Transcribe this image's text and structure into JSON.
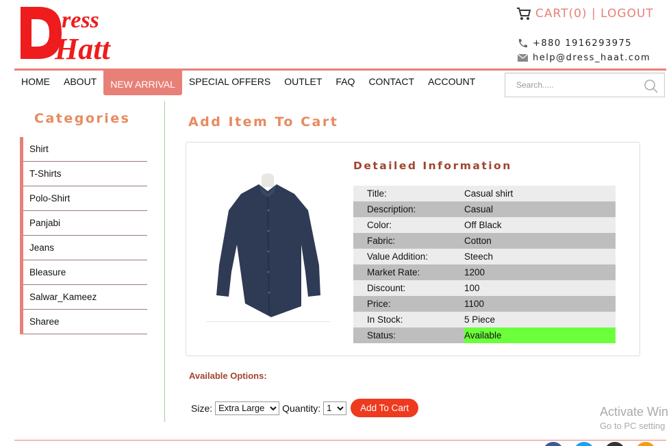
{
  "header": {
    "logo_text": "Dress Haat",
    "cart_label": "CART(0) | LOGOUT",
    "phone": "+880 1916293975",
    "email": "help@dress_haat.com"
  },
  "nav": {
    "items": [
      {
        "label": "HOME"
      },
      {
        "label": "ABOUT"
      },
      {
        "label": "NEW ARRIVAL",
        "active": true
      },
      {
        "label": "SPECIAL OFFERS"
      },
      {
        "label": "OUTLET"
      },
      {
        "label": "FAQ"
      },
      {
        "label": "CONTACT"
      },
      {
        "label": "ACCOUNT"
      }
    ]
  },
  "search": {
    "placeholder": "Search.....",
    "value": ""
  },
  "sidebar": {
    "title": "Categories",
    "items": [
      {
        "label": "Shirt"
      },
      {
        "label": "T-Shirts"
      },
      {
        "label": "Polo-Shirt"
      },
      {
        "label": "Panjabi"
      },
      {
        "label": "Jeans"
      },
      {
        "label": "Bleasure"
      },
      {
        "label": "Salwar_Kameez"
      },
      {
        "label": "Sharee"
      }
    ]
  },
  "main": {
    "title": "Add Item To Cart",
    "detail_title": "Detailed Information",
    "details": [
      {
        "key": "Title:",
        "value": "Casual shirt"
      },
      {
        "key": "Description:",
        "value": "Casual"
      },
      {
        "key": "Color:",
        "value": "Off Black"
      },
      {
        "key": "Fabric:",
        "value": "Cotton"
      },
      {
        "key": "Value Addition:",
        "value": "Steech"
      },
      {
        "key": "Market Rate:",
        "value": "1200"
      },
      {
        "key": "Discount:",
        "value": "100"
      },
      {
        "key": "Price:",
        "value": "1100"
      },
      {
        "key": "In Stock:",
        "value": "5 Piece"
      },
      {
        "key": "Status:",
        "value": "Available"
      }
    ],
    "options": {
      "title": "Available Options:",
      "size_label": "Size:",
      "size_value": "Extra Large",
      "quantity_label": "Quantity:",
      "quantity_value": "1",
      "add_button": "Add To Cart"
    }
  },
  "watermark": {
    "line1": "Activate Win",
    "line2": "Go to PC setting"
  },
  "colors": {
    "accent": "#e88078",
    "heading": "#e88a60",
    "detail_heading": "#a0452e",
    "button": "#ee3a1e",
    "status_ok": "#6cff3c",
    "sidebar_rule": "#9fd09b"
  }
}
